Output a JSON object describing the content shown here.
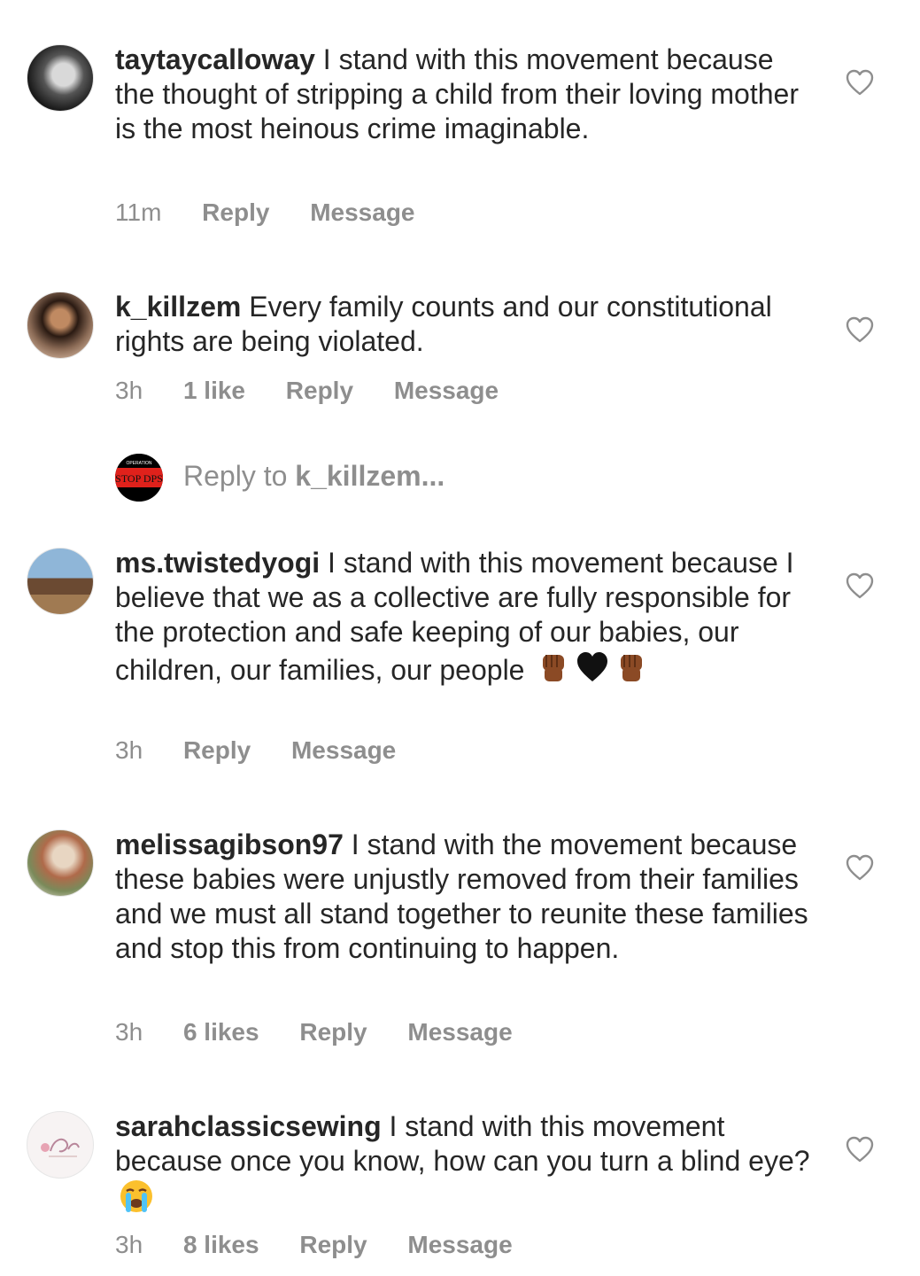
{
  "comments": [
    {
      "username": "taytaycalloway",
      "text": " I stand with this movement because the thought of stripping a child from their loving mother is the most heinous crime imaginable.",
      "time": "11m",
      "likes": "",
      "reply": "Reply",
      "message": "Message"
    },
    {
      "username": "k_killzem",
      "text": " Every family counts and our constitutional rights are being violated.",
      "time": "3h",
      "likes": "1 like",
      "reply": "Reply",
      "message": "Message"
    },
    {
      "username": "ms.twistedyogi",
      "text": " I stand with this movement because I believe that we as a collective are fully responsible for the protection and safe keeping of our babies, our children, our families, our people ",
      "time": "3h",
      "likes": "",
      "reply": "Reply",
      "message": "Message"
    },
    {
      "username": "melissagibson97",
      "text": " I stand with the movement because these babies were unjustly removed from their families and we must all stand together to reunite these families and stop this from continuing to happen.",
      "time": "3h",
      "likes": "6 likes",
      "reply": "Reply",
      "message": "Message"
    },
    {
      "username": "sarahclassicsewing",
      "text": " I stand with this movement because once you know, how can you turn a blind eye? ",
      "time": "3h",
      "likes": "8 likes",
      "reply": "Reply",
      "message": "Message"
    }
  ],
  "reply_prompt": {
    "prefix": "Reply to ",
    "target": "k_killzem...",
    "avatar_text_top": "OPERATION",
    "avatar_text": "STOP DPS"
  },
  "colors": {
    "text": "#262626",
    "secondary": "#8e8e8e",
    "accent_red": "#e0211b"
  },
  "icons": {
    "like": "heart-outline-icon"
  }
}
